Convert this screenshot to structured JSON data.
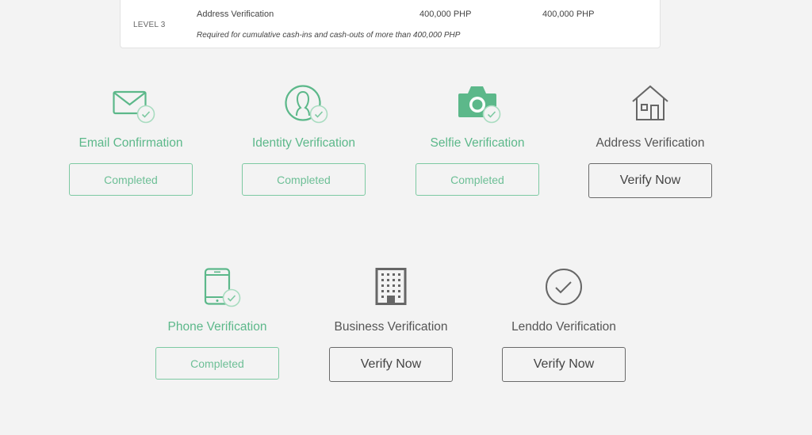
{
  "levels_table": {
    "row": {
      "level": "LEVEL 3",
      "requirement": "Address Verification",
      "cash_in_limit": "400,000 PHP",
      "cash_out_limit": "400,000 PHP",
      "note": "Required for cumulative cash-ins and cash-outs of more than 400,000 PHP"
    }
  },
  "colors": {
    "accent_green": "#5cb88a",
    "neutral": "#666666"
  },
  "verifications": [
    {
      "title": "Email Confirmation",
      "icon": "envelope-icon",
      "status": "completed",
      "button_label": "Completed"
    },
    {
      "title": "Identity Verification",
      "icon": "user-circle-icon",
      "status": "completed",
      "button_label": "Completed"
    },
    {
      "title": "Selfie Verification",
      "icon": "camera-icon",
      "status": "completed",
      "button_label": "Completed"
    },
    {
      "title": "Address Verification",
      "icon": "house-icon",
      "status": "pending",
      "button_label": "Verify Now"
    },
    {
      "title": "Phone Verification",
      "icon": "phone-icon",
      "status": "completed",
      "button_label": "Completed"
    },
    {
      "title": "Business Verification",
      "icon": "building-icon",
      "status": "pending",
      "button_label": "Verify Now"
    },
    {
      "title": "Lenddo Verification",
      "icon": "check-circle-icon",
      "status": "pending",
      "button_label": "Verify Now"
    }
  ]
}
